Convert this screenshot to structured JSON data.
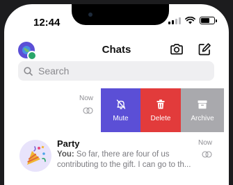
{
  "status_bar": {
    "time": "12:44"
  },
  "header": {
    "title": "Chats"
  },
  "search": {
    "placeholder": "Search"
  },
  "swiped_chat": {
    "time": "Now",
    "actions": [
      {
        "label": "Mute",
        "icon": "bell-slash-icon"
      },
      {
        "label": "Delete",
        "icon": "trash-icon"
      },
      {
        "label": "Archive",
        "icon": "archive-box-icon"
      }
    ]
  },
  "party_chat": {
    "name": "Party",
    "sender": "You:",
    "preview_line1": "So far, there are four of us",
    "preview_line2": "contributing to the gift. I can go to th...",
    "time": "Now"
  },
  "colors": {
    "accent": "#5b4fd6",
    "delete": "#e23b3b",
    "archive": "#a9a9ad"
  }
}
